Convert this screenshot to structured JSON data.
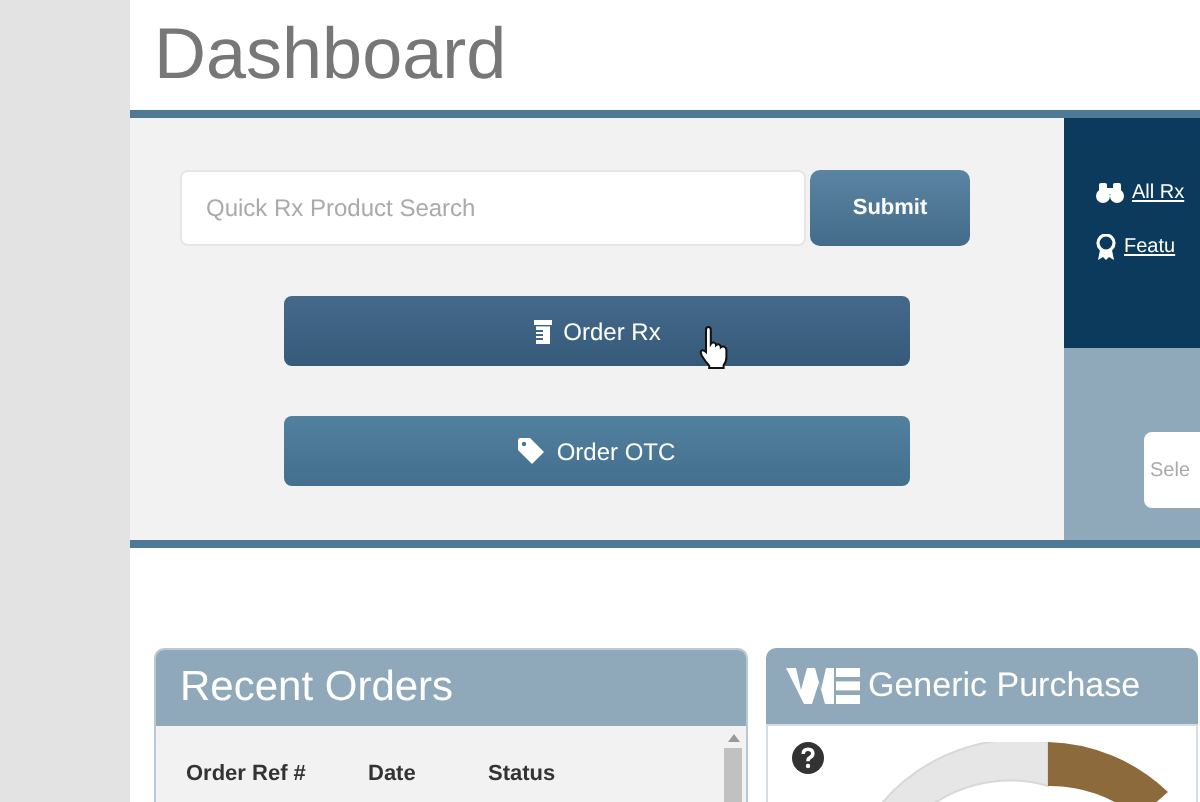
{
  "page": {
    "title": "Dashboard"
  },
  "quick_search": {
    "placeholder": "Quick Rx Product Search",
    "submit": "Submit"
  },
  "order_buttons": [
    {
      "kind": "rx",
      "label": "Order Rx"
    },
    {
      "kind": "otc",
      "label": "Order OTC"
    }
  ],
  "side_links": [
    {
      "kind": "binoculars",
      "label": "All Rx"
    },
    {
      "kind": "award",
      "label": "Featu"
    }
  ],
  "select": {
    "placeholder": "Sele"
  },
  "recent_orders": {
    "title": "Recent Orders",
    "columns": [
      "Order Ref #",
      "Date",
      "Status"
    ]
  },
  "generic_purchases": {
    "title": "Generic Purchase"
  }
}
